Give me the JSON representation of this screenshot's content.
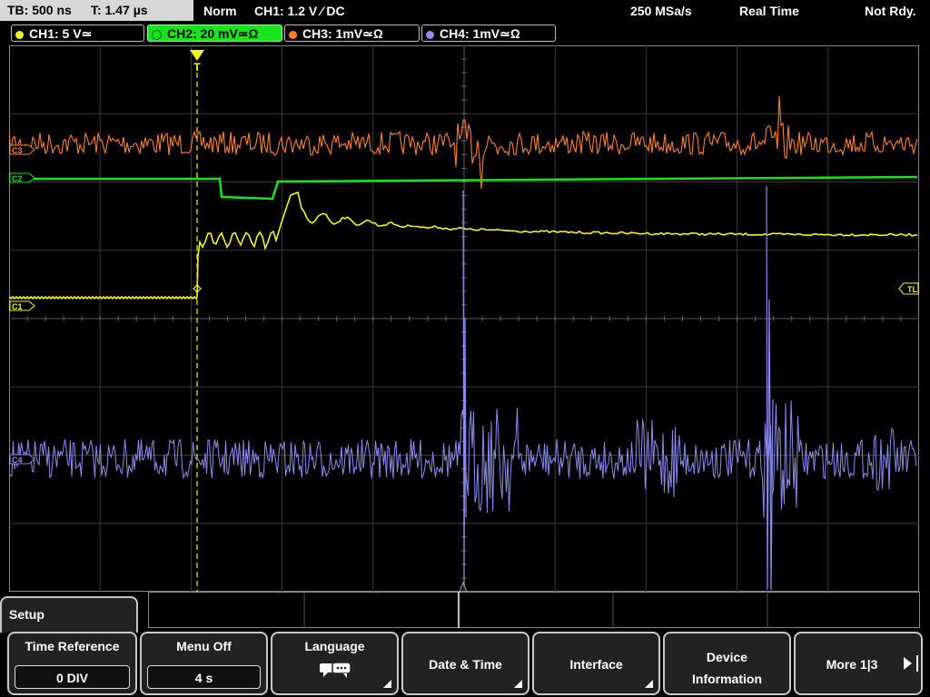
{
  "topbar": {
    "timebase": "TB: 500 ns",
    "trigger_time": "T: 1.47 µs",
    "trigger_mode": "Norm",
    "trigger_info": "CH1: 1.2 V ∕ DC",
    "sample_rate": "250 MSa/s",
    "acq_mode": "Real Time",
    "ready_state": "Not Rdy."
  },
  "channels": [
    {
      "label": "CH1: 5 V≃",
      "color": "#f2f21e",
      "active": false
    },
    {
      "label": "CH2: 20 mV≃Ω",
      "color": "#1be31b",
      "active": true
    },
    {
      "label": "CH3: 1mV≃Ω",
      "color": "#ff7f2a",
      "active": false
    },
    {
      "label": "CH4: 1mV≃Ω",
      "color": "#8c8cf0",
      "active": false
    }
  ],
  "markers": {
    "trigger_level": "TL",
    "ch1": "C1",
    "ch2": "C2",
    "ch3": "C3",
    "ch4": "C4"
  },
  "menu": {
    "title": "Setup",
    "softkeys": [
      {
        "label": "Time Reference",
        "value": "0 DIV"
      },
      {
        "label": "Menu Off",
        "value": "4 s"
      },
      {
        "label": "Language",
        "icon": "speech-bubbles-icon"
      },
      {
        "label": "Date & Time"
      },
      {
        "label": "Interface"
      },
      {
        "label": "Device",
        "label2": "Information"
      },
      {
        "label": "More 1|3"
      }
    ]
  }
}
